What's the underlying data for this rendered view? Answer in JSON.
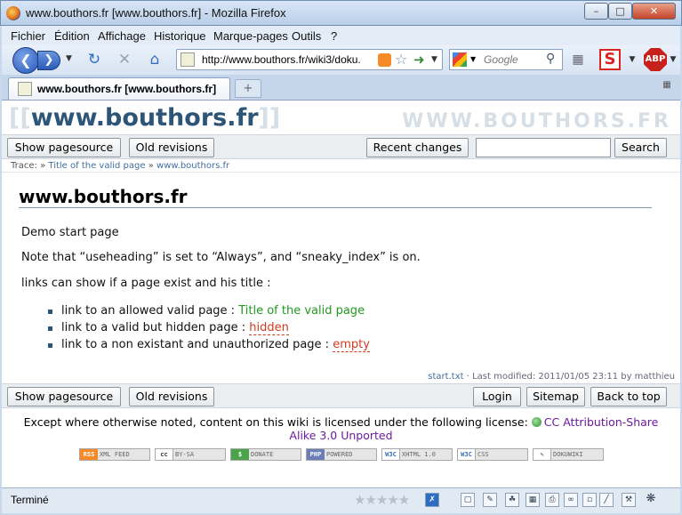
{
  "window": {
    "title": "www.bouthors.fr [www.bouthors.fr] - Mozilla Firefox"
  },
  "menu": [
    "Fichier",
    "Édition",
    "Affichage",
    "Historique",
    "Marque-pages",
    "Outils",
    "?"
  ],
  "nav": {
    "url": "http://www.bouthors.fr/wiki3/doku.",
    "search_placeholder": "Google"
  },
  "tab": {
    "label": "www.bouthors.fr [www.bouthors.fr]"
  },
  "page": {
    "brand_prefix": "[[",
    "brand_name": "www.bouthors.fr",
    "brand_suffix": "]]",
    "brand_right": "WWW.BOUTHORS.FR",
    "top_buttons": {
      "pagesource": "Show pagesource",
      "old_revisions": "Old revisions",
      "recent_changes": "Recent changes",
      "search": "Search"
    },
    "trace": {
      "label": "Trace:",
      "sep": "»",
      "items": [
        "Title of the valid page",
        "www.bouthors.fr"
      ]
    },
    "heading": "www.bouthors.fr",
    "paragraphs": [
      "Demo start page",
      "Note that “useheading” is set to “Always”, and “sneaky_index” is on.",
      "links can show if a page exist and his title :"
    ],
    "list": [
      {
        "text": "link to an allowed valid page :",
        "link": "Title of the valid page",
        "status": "ok"
      },
      {
        "text": "link to a valid but hidden page :",
        "link": "hidden",
        "status": "bad"
      },
      {
        "text": "link to a non existant and unauthorized page :",
        "link": "empty",
        "status": "bad"
      }
    ],
    "modified": {
      "file": "start.txt",
      "text": "· Last modified: 2011/01/05 23:11 by matthieu"
    },
    "bottom_buttons": {
      "pagesource": "Show pagesource",
      "old_revisions": "Old revisions",
      "login": "Login",
      "sitemap": "Sitemap",
      "back_to_top": "Back to top"
    },
    "license": {
      "text": "Except where otherwise noted, content on this wiki is licensed under the following license:",
      "link_line1": "CC Attribution-Share",
      "link_line2": "Alike 3.0 Unported"
    },
    "badges": [
      "XML FEED",
      "BY-SA",
      "DONATE",
      "POWERED",
      "XHTML 1.0",
      "CSS",
      "DOKUWIKI"
    ]
  },
  "status": {
    "text": "Terminé"
  },
  "colors": {
    "accent": "#2d5577",
    "valid_link": "#1f9a1f",
    "missing_link": "#d43a1f",
    "license_link": "#6b1aa0"
  }
}
